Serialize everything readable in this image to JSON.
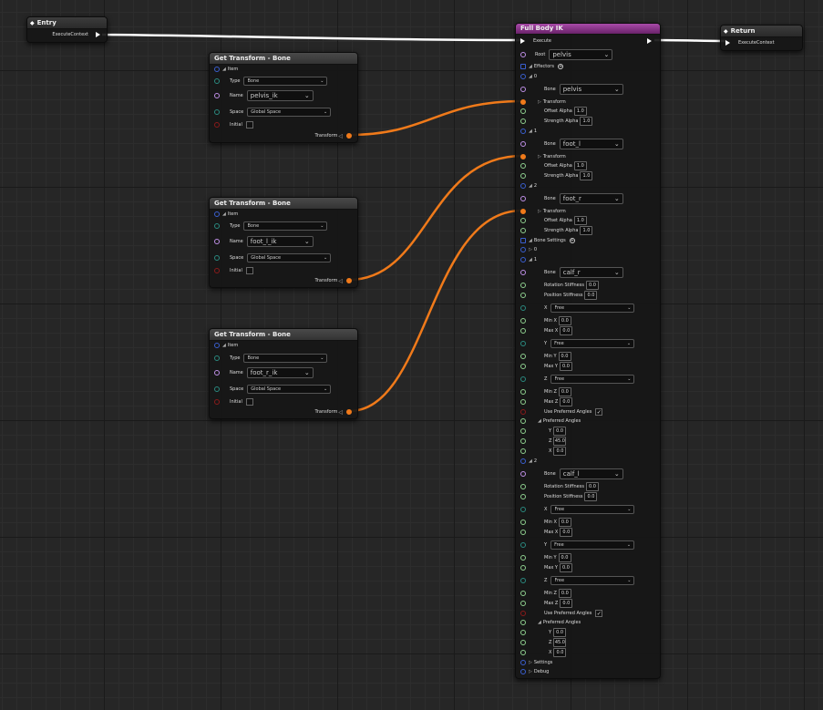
{
  "entry": {
    "title": "Entry",
    "exec_label": "ExecuteContext"
  },
  "ret": {
    "title": "Return",
    "exec_label": "ExecuteContext"
  },
  "gt_nodes": [
    {
      "title": "Get Transform - Bone",
      "item_label": "Item",
      "type_label": "Type",
      "type_value": "Bone",
      "name_label": "Name",
      "name_value": "pelvis_ik",
      "space_label": "Space",
      "space_value": "Global Space",
      "initial_label": "Initial",
      "out_label": "Transform"
    },
    {
      "title": "Get Transform - Bone",
      "item_label": "Item",
      "type_label": "Type",
      "type_value": "Bone",
      "name_label": "Name",
      "name_value": "foot_l_ik",
      "space_label": "Space",
      "space_value": "Global Space",
      "initial_label": "Initial",
      "out_label": "Transform"
    },
    {
      "title": "Get Transform - Bone",
      "item_label": "Item",
      "type_label": "Type",
      "type_value": "Bone",
      "name_label": "Name",
      "name_value": "foot_r_ik",
      "space_label": "Space",
      "space_value": "Global Space",
      "initial_label": "Initial",
      "out_label": "Transform"
    }
  ],
  "fbik": {
    "title": "Full Body IK",
    "execute": "Execute",
    "root_label": "Root",
    "root_value": "pelvis",
    "effectors_label": "Effectors",
    "effectors": [
      {
        "index": "0",
        "bone_label": "Bone",
        "bone": "pelvis",
        "transform": "Transform",
        "offset_label": "Offset Alpha",
        "offset": "1.0",
        "strength_label": "Strength Alpha",
        "strength": "1.0"
      },
      {
        "index": "1",
        "bone_label": "Bone",
        "bone": "foot_l",
        "transform": "Transform",
        "offset_label": "Offset Alpha",
        "offset": "1.0",
        "strength_label": "Strength Alpha",
        "strength": "1.0"
      },
      {
        "index": "2",
        "bone_label": "Bone",
        "bone": "foot_r",
        "transform": "Transform",
        "offset_label": "Offset Alpha",
        "offset": "1.0",
        "strength_label": "Strength Alpha",
        "strength": "1.0"
      }
    ],
    "bone_settings_label": "Bone Settings",
    "bs0_index": "0",
    "bone_settings": [
      {
        "index": "1",
        "bone_label": "Bone",
        "bone": "calf_r",
        "rot_label": "Rotation Stiffness",
        "rot": "0.0",
        "pos_label": "Position Stiffness",
        "pos": "0.0",
        "x_label": "X",
        "x_value": "Free",
        "minx_label": "Min X",
        "minx": "0.0",
        "maxx_label": "Max X",
        "maxx": "0.0",
        "y_label": "Y",
        "y_value": "Free",
        "miny_label": "Min Y",
        "miny": "0.0",
        "maxy_label": "Max Y",
        "maxy": "0.0",
        "z_label": "Z",
        "z_value": "Free",
        "minz_label": "Min Z",
        "minz": "0.0",
        "maxz_label": "Max Z",
        "maxz": "0.0",
        "use_pref_label": "Use Preferred Angles",
        "pref_label": "Preferred Angles",
        "pa_y_label": "Y",
        "pa_y": "0.0",
        "pa_z_label": "Z",
        "pa_z": "45.0",
        "pa_x_label": "X",
        "pa_x": "0.0"
      },
      {
        "index": "2",
        "bone_label": "Bone",
        "bone": "calf_l",
        "rot_label": "Rotation Stiffness",
        "rot": "0.0",
        "pos_label": "Position Stiffness",
        "pos": "0.0",
        "x_label": "X",
        "x_value": "Free",
        "minx_label": "Min X",
        "minx": "0.0",
        "maxx_label": "Max X",
        "maxx": "0.0",
        "y_label": "Y",
        "y_value": "Free",
        "miny_label": "Min Y",
        "miny": "0.0",
        "maxy_label": "Max Y",
        "maxy": "0.0",
        "z_label": "Z",
        "z_value": "Free",
        "minz_label": "Min Z",
        "minz": "0.0",
        "maxz_label": "Max Z",
        "maxz": "0.0",
        "use_pref_label": "Use Preferred Angles",
        "pref_label": "Preferred Angles",
        "pa_y_label": "Y",
        "pa_y": "0.0",
        "pa_z_label": "Z",
        "pa_z": "45.0",
        "pa_x_label": "X",
        "pa_x": "0.0"
      }
    ],
    "settings_label": "Settings",
    "debug_label": "Debug"
  },
  "colors": {
    "transform_wire": "#f07a1a",
    "exec_wire": "#ffffff",
    "fbik_header": "#8a3a8a",
    "background": "#262626"
  }
}
